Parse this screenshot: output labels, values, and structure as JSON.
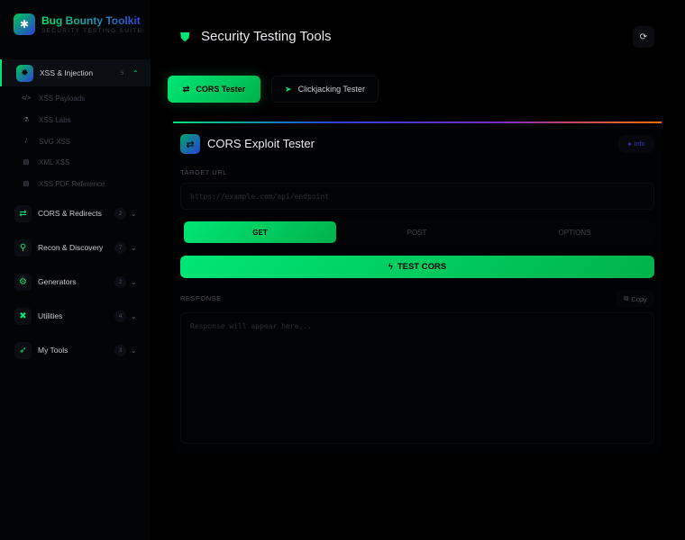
{
  "sidebar": {
    "brand": "Bug Bounty Toolkit",
    "subtitle": "SECURITY TESTING SUITE",
    "categories": [
      {
        "label": "XSS & Injection",
        "count": "5",
        "icon": "bug-icon",
        "expanded": true,
        "items": [
          {
            "label": "XSS Payloads",
            "icon": "code-icon"
          },
          {
            "label": "XSS Labs",
            "icon": "flask-icon"
          },
          {
            "label": "SVG XSS",
            "icon": "brush-icon"
          },
          {
            "label": "XML XSS",
            "icon": "file-code-icon"
          },
          {
            "label": "XSS PDF Reference",
            "icon": "file-pdf-icon"
          }
        ]
      },
      {
        "label": "CORS & Redirects",
        "count": "2",
        "icon": "exchange-icon"
      },
      {
        "label": "Recon & Discovery",
        "count": "7",
        "icon": "search-icon"
      },
      {
        "label": "Generators",
        "count": "2",
        "icon": "gears-icon"
      },
      {
        "label": "Utilities",
        "count": "4",
        "icon": "tools-icon"
      },
      {
        "label": "My Tools",
        "count": "3",
        "icon": "rocket-icon"
      }
    ]
  },
  "header": {
    "title": "Security Testing Tools"
  },
  "tabs": [
    {
      "label": "CORS Tester",
      "active": true
    },
    {
      "label": "Clickjacking Tester",
      "active": false
    }
  ],
  "card": {
    "title": "CORS Exploit Tester",
    "info_label": "Info",
    "target_label": "TARGET URL",
    "target_placeholder": "https://example.com/api/endpoint",
    "methods": [
      "GET",
      "POST",
      "OPTIONS"
    ],
    "selected_method": "GET",
    "test_label": "TEST CORS",
    "response_label": "RESPONSE",
    "copy_label": "Copy",
    "response_placeholder": "Response will appear here..."
  },
  "colors": {
    "accent": "#00e676",
    "brand_blue": "#2b3fd8"
  }
}
